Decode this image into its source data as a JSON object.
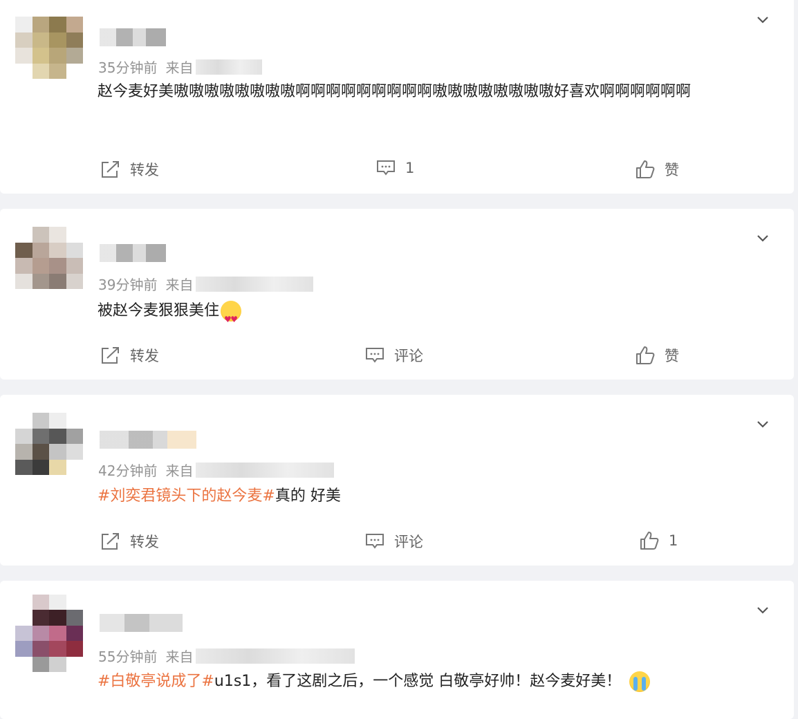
{
  "posts": [
    {
      "time": "35分钟前",
      "source_prefix": "来自",
      "content": "赵今麦好美嗷嗷嗷嗷嗷嗷嗷嗷啊啊啊啊啊啊啊啊啊嗷嗷嗷嗷嗷嗷嗷嗷好喜欢啊啊啊啊啊啊",
      "repost_label": "转发",
      "comment_label": "1",
      "like_label": "赞"
    },
    {
      "time": "39分钟前",
      "source_prefix": "来自",
      "content": "被赵今麦狠狠美住",
      "emoji": "heart-eyes-emoji",
      "repost_label": "转发",
      "comment_label": "评论",
      "like_label": "赞"
    },
    {
      "time": "42分钟前",
      "source_prefix": "来自",
      "hashtag": "#刘奕君镜头下的赵今麦#",
      "content": "真的 好美",
      "repost_label": "转发",
      "comment_label": "评论",
      "like_label": "1"
    },
    {
      "time": "55分钟前",
      "source_prefix": "来自",
      "hashtag": "#白敬亭说成了#",
      "content": "u1s1，看了这剧之后，一个感觉 白敬亭好帅！赵今麦好美！",
      "emoji": "crying-emoji"
    }
  ],
  "colors": {
    "hashtag": "#eb7340",
    "meta": "#939393",
    "action": "#666666",
    "background": "#f1f2f5"
  },
  "icons": {
    "repost": "repost-icon",
    "comment": "comment-icon",
    "like": "thumbs-up-icon",
    "menu": "chevron-down-icon"
  }
}
